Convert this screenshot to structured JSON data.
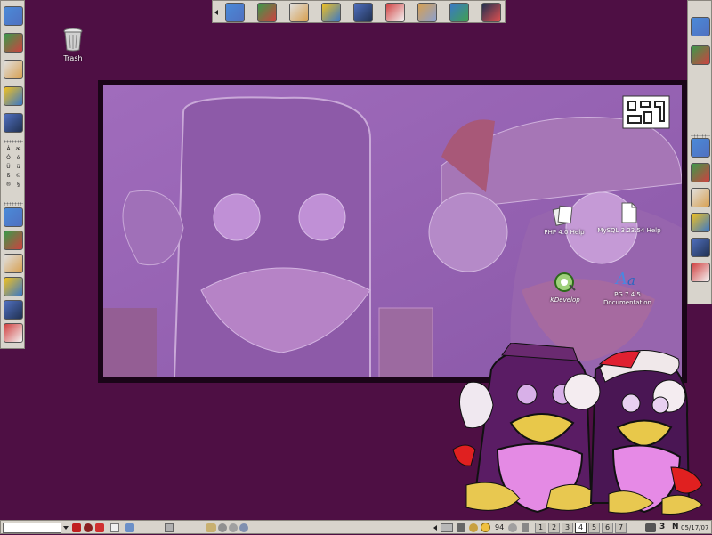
{
  "colors": {
    "desktop": "#4e0f44",
    "panel": "#d8d4cc",
    "wallpaper": "#9a66b2",
    "accent": "#6a2a8a"
  },
  "top_toolbar": {
    "icons": [
      "network-icon",
      "spreadsheet-icon",
      "compass-icon",
      "cubes-icon",
      "book-icon",
      "printer-icon",
      "folder-home-icon",
      "globe-document-icon",
      "terminal-icon"
    ]
  },
  "left_panel": {
    "icons_top": [
      "pencil-tool-icon",
      "clipboard-pencil-icon",
      "paint-brush-icon",
      "diamond-icon",
      "stack-windows-icon"
    ],
    "char_grid": [
      "À",
      "æ",
      "Ó",
      "ó",
      "Ü",
      "ü",
      "ß",
      "©",
      "®",
      "§"
    ],
    "icons_bottom": [
      "green-cube-icon",
      "gimp-icon",
      "drawing-app-icon",
      "pencils-icon",
      "gear-icon",
      "monitor-magnifier-icon"
    ]
  },
  "right_panel": {
    "icons_top": [
      "open-book-icon",
      "globe-icon"
    ],
    "icons_bottom": [
      "world-icon",
      "mail-globe-icon",
      "satellite-icon",
      "chat-face-icon",
      "sleep-z-icon",
      "kde-help-icon"
    ]
  },
  "desktop_icons": {
    "trash": "Trash",
    "php_help": "PHP 4.0 Help",
    "mysql_help": "MySQL 3.23.54 Help",
    "kdevelop": "KDevelop",
    "pg_docs": "PG 7.4.5 Documentation"
  },
  "taskbar": {
    "input_value": "",
    "cpu_label": "94",
    "pager": [
      "1",
      "2",
      "3",
      "4",
      "5",
      "6",
      "7"
    ],
    "active_desktop": "4",
    "lang_indicator": "3",
    "clock_letter": "N",
    "date": "05/17/07"
  }
}
